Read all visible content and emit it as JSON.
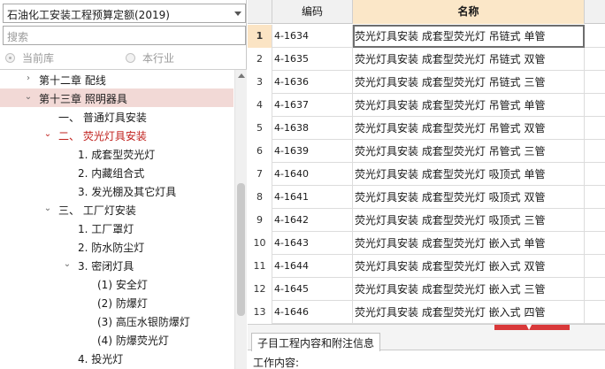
{
  "library_select": {
    "value": "石油化工安装工程预算定额(2019)"
  },
  "search": {
    "placeholder": "搜索"
  },
  "scope": {
    "current_lib": "当前库",
    "industry": "本行业"
  },
  "tree": [
    {
      "label": "第十二章  配线",
      "exp": "›",
      "state": "collapsed"
    },
    {
      "label": "第十三章  照明器具",
      "exp": "⌄",
      "state": "expanded",
      "selected": true
    },
    {
      "label": "一、 普通灯具安装",
      "exp": ""
    },
    {
      "label": "二、 荧光灯具安装",
      "exp": "⌄",
      "red": true
    },
    {
      "label": "1.  成套型荧光灯",
      "exp": ""
    },
    {
      "label": "2.  内藏组合式",
      "exp": ""
    },
    {
      "label": "3.  发光棚及其它灯具",
      "exp": ""
    },
    {
      "label": "三、  工厂灯安装",
      "exp": "⌄"
    },
    {
      "label": "1.  工厂罩灯",
      "exp": ""
    },
    {
      "label": "2.  防水防尘灯",
      "exp": ""
    },
    {
      "label": "3.  密闭灯具",
      "exp": "⌄"
    },
    {
      "label": "(1) 安全灯",
      "exp": ""
    },
    {
      "label": "(2) 防爆灯",
      "exp": ""
    },
    {
      "label": "(3) 高压水银防爆灯",
      "exp": ""
    },
    {
      "label": "(4) 防爆荧光灯",
      "exp": ""
    },
    {
      "label": "4.  投光灯",
      "exp": ""
    }
  ],
  "grid": {
    "headers": {
      "code": "编码",
      "name": "名称"
    },
    "rows": [
      {
        "no": "1",
        "code": "4-1634",
        "name": "荧光灯具安装 成套型荧光灯 吊链式 单管"
      },
      {
        "no": "2",
        "code": "4-1635",
        "name": "荧光灯具安装 成套型荧光灯 吊链式 双管"
      },
      {
        "no": "3",
        "code": "4-1636",
        "name": "荧光灯具安装 成套型荧光灯 吊链式 三管"
      },
      {
        "no": "4",
        "code": "4-1637",
        "name": "荧光灯具安装 成套型荧光灯 吊管式 单管"
      },
      {
        "no": "5",
        "code": "4-1638",
        "name": "荧光灯具安装 成套型荧光灯 吊管式 双管"
      },
      {
        "no": "6",
        "code": "4-1639",
        "name": "荧光灯具安装 成套型荧光灯 吊管式 三管"
      },
      {
        "no": "7",
        "code": "4-1640",
        "name": "荧光灯具安装 成套型荧光灯 吸顶式 单管"
      },
      {
        "no": "8",
        "code": "4-1641",
        "name": "荧光灯具安装 成套型荧光灯 吸顶式 双管"
      },
      {
        "no": "9",
        "code": "4-1642",
        "name": "荧光灯具安装 成套型荧光灯 吸顶式 三管"
      },
      {
        "no": "10",
        "code": "4-1643",
        "name": "荧光灯具安装 成套型荧光灯 嵌入式 单管"
      },
      {
        "no": "11",
        "code": "4-1644",
        "name": "荧光灯具安装 成套型荧光灯 嵌入式 双管"
      },
      {
        "no": "12",
        "code": "4-1645",
        "name": "荧光灯具安装 成套型荧光灯 嵌入式 三管"
      },
      {
        "no": "13",
        "code": "4-1646",
        "name": "荧光灯具安装 成套型荧光灯 嵌入式 四管"
      }
    ]
  },
  "bottom": {
    "tab": "子目工程内容和附注信息",
    "work_label": "工作内容:"
  }
}
